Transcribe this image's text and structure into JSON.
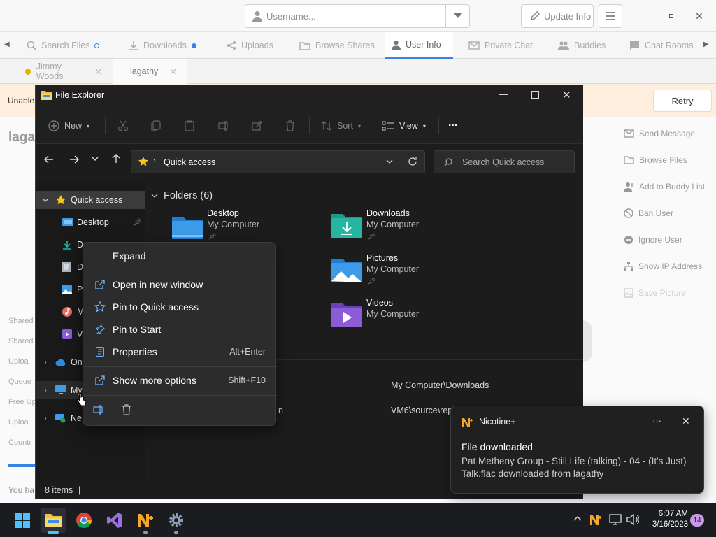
{
  "nicotine": {
    "username_placeholder": "Username...",
    "update_info": "Update Info",
    "tabs": [
      {
        "label": "Search Files",
        "icon": "search-icon"
      },
      {
        "label": "Downloads",
        "icon": "download-icon"
      },
      {
        "label": "Uploads",
        "icon": "upload-icon"
      },
      {
        "label": "Browse Shares",
        "icon": "folder-icon"
      },
      {
        "label": "User Info",
        "icon": "user-icon"
      },
      {
        "label": "Private Chat",
        "icon": "mail-icon"
      },
      {
        "label": "Buddies",
        "icon": "people-icon"
      },
      {
        "label": "Chat Rooms",
        "icon": "chat-icon"
      }
    ],
    "user_tabs": [
      "Jimmy Woods",
      "lagathy"
    ],
    "warning_text": "Unable",
    "retry": "Retry",
    "heading_partial": "laga",
    "left_labels": [
      "Shared",
      "Shared",
      "Uploa",
      "Queue",
      "Free Up",
      "Uploa",
      "Countr"
    ],
    "bottom_text": "You ha",
    "actions": [
      "Send Message",
      "Browse Files",
      "Add to Buddy List",
      "Ban User",
      "Ignore User",
      "Show IP Address",
      "Save Picture"
    ]
  },
  "explorer": {
    "title": "File Explorer",
    "cmd": {
      "new": "New",
      "sort": "Sort",
      "view": "View",
      "more": "..."
    },
    "address": "Quick access",
    "search_placeholder": "Search Quick access",
    "nav": {
      "quick_access": "Quick access",
      "desktop": "Desktop",
      "d1": "D",
      "d2": "D",
      "p": "P",
      "m": "M",
      "v": "V",
      "onedrive": "On",
      "mypc": "My",
      "network": "Ne"
    },
    "section_title": "Folders (6)",
    "folders": [
      {
        "name": "Desktop",
        "sub": "My Computer"
      },
      {
        "name": "Downloads",
        "sub": "My Computer"
      },
      {
        "name": "Pictures",
        "sub": "My Computer"
      },
      {
        "name": "Videos",
        "sub": "My Computer"
      }
    ],
    "recent": [
      {
        "name": "",
        "path": "My Computer\\Downloads"
      },
      {
        "name": "n",
        "path": "VM6\\source\\rep"
      }
    ],
    "status": "8 items"
  },
  "context_menu": {
    "expand": "Expand",
    "open_new_window": "Open in new window",
    "pin_quick_access": "Pin to Quick access",
    "pin_start": "Pin to Start",
    "properties": "Properties",
    "properties_shortcut": "Alt+Enter",
    "show_more": "Show more options",
    "show_more_shortcut": "Shift+F10"
  },
  "toast": {
    "app": "Nicotine+",
    "more": "···",
    "title": "File downloaded",
    "body1": "Pat Metheny Group - Still Life (talking) - 04 - (It's Just)",
    "body2": "Talk.flac downloaded from lagathy"
  },
  "taskbar": {
    "time": "6:07 AM",
    "date": "3/16/2023",
    "notif_count": "14"
  },
  "colors": {
    "accent": "#3584e4",
    "explorer_bg": "#202020",
    "taskbar_bg": "#1a1c20",
    "folder_blue": "#3d9be9",
    "folder_teal": "#26b5a0"
  }
}
